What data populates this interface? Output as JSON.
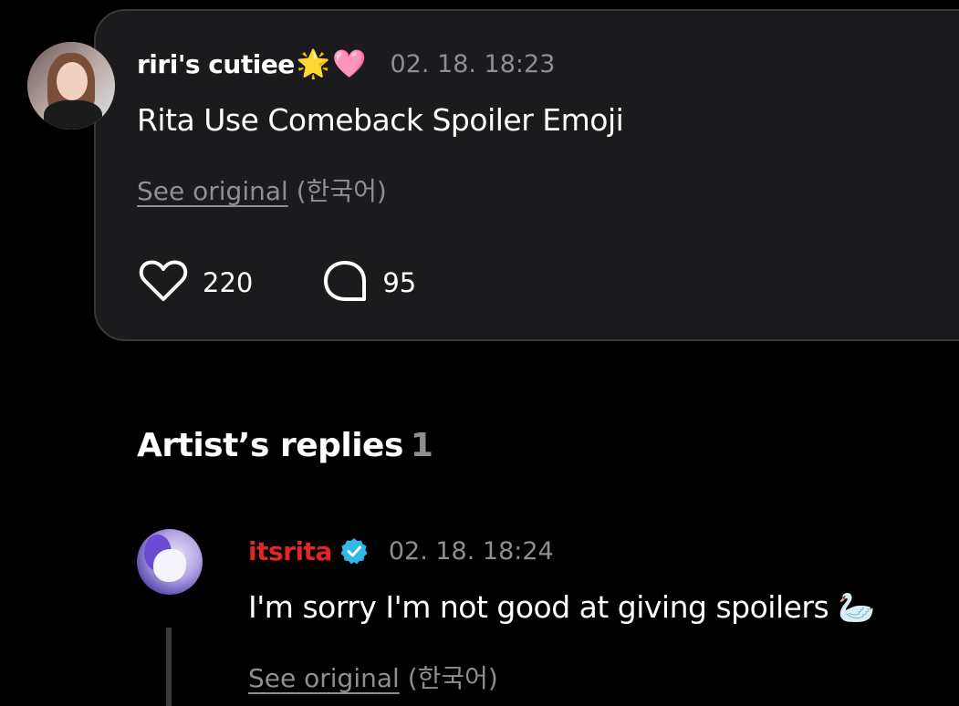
{
  "post": {
    "username": "riri's cutiee",
    "username_emojis": [
      "🌟",
      "🩷"
    ],
    "timestamp": "02. 18. 18:23",
    "text": "Rita Use Comeback Spoiler Emoji",
    "see_original_link": "See original",
    "see_original_lang": "(한국어)",
    "like_count": "220",
    "comment_count": "95",
    "like_icon": "heart-outline-icon",
    "comment_icon": "speech-bubble-outline-icon"
  },
  "replies_section": {
    "title": "Artist’s replies",
    "count": "1"
  },
  "reply": {
    "artist_name": "itsrita",
    "verified_icon": "verified-badge-icon",
    "timestamp": "02. 18. 18:24",
    "text": "I'm sorry I'm not good at giving spoilers",
    "text_emoji": "🦢",
    "see_original_link": "See original",
    "see_original_lang": "(한국어)"
  },
  "colors": {
    "background": "#000000",
    "card": "#1b1b1d",
    "card_border": "#38383a",
    "muted": "#8e8e93",
    "artist_red": "#e0252b",
    "verified_blue": "#2fb8e8"
  }
}
